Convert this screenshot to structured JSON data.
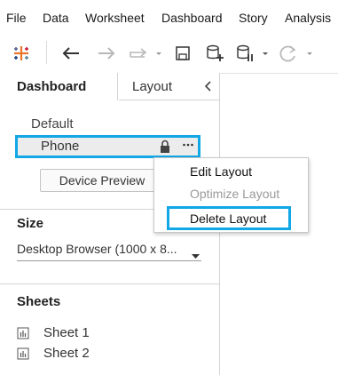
{
  "menu": [
    "File",
    "Data",
    "Worksheet",
    "Dashboard",
    "Story",
    "Analysis"
  ],
  "toolbar": {
    "icons": [
      "tableau-logo-icon",
      "back-arrow-icon",
      "forward-arrow-icon",
      "redo-icon",
      "save-icon",
      "new-data-source-icon",
      "pause-data-icon",
      "refresh-icon"
    ],
    "accent": "#12a7e5"
  },
  "panel": {
    "tabs": {
      "dashboard": "Dashboard",
      "layout": "Layout"
    },
    "layouts": {
      "default_label": "Default",
      "phone_label": "Phone"
    },
    "device_preview": "Device Preview",
    "size": {
      "heading": "Size",
      "value": "Desktop Browser (1000 x 8..."
    },
    "sheets": {
      "heading": "Sheets",
      "items": [
        "Sheet 1",
        "Sheet 2"
      ]
    }
  },
  "context_menu": {
    "edit": "Edit Layout",
    "optimize": "Optimize Layout",
    "delete": "Delete Layout"
  }
}
